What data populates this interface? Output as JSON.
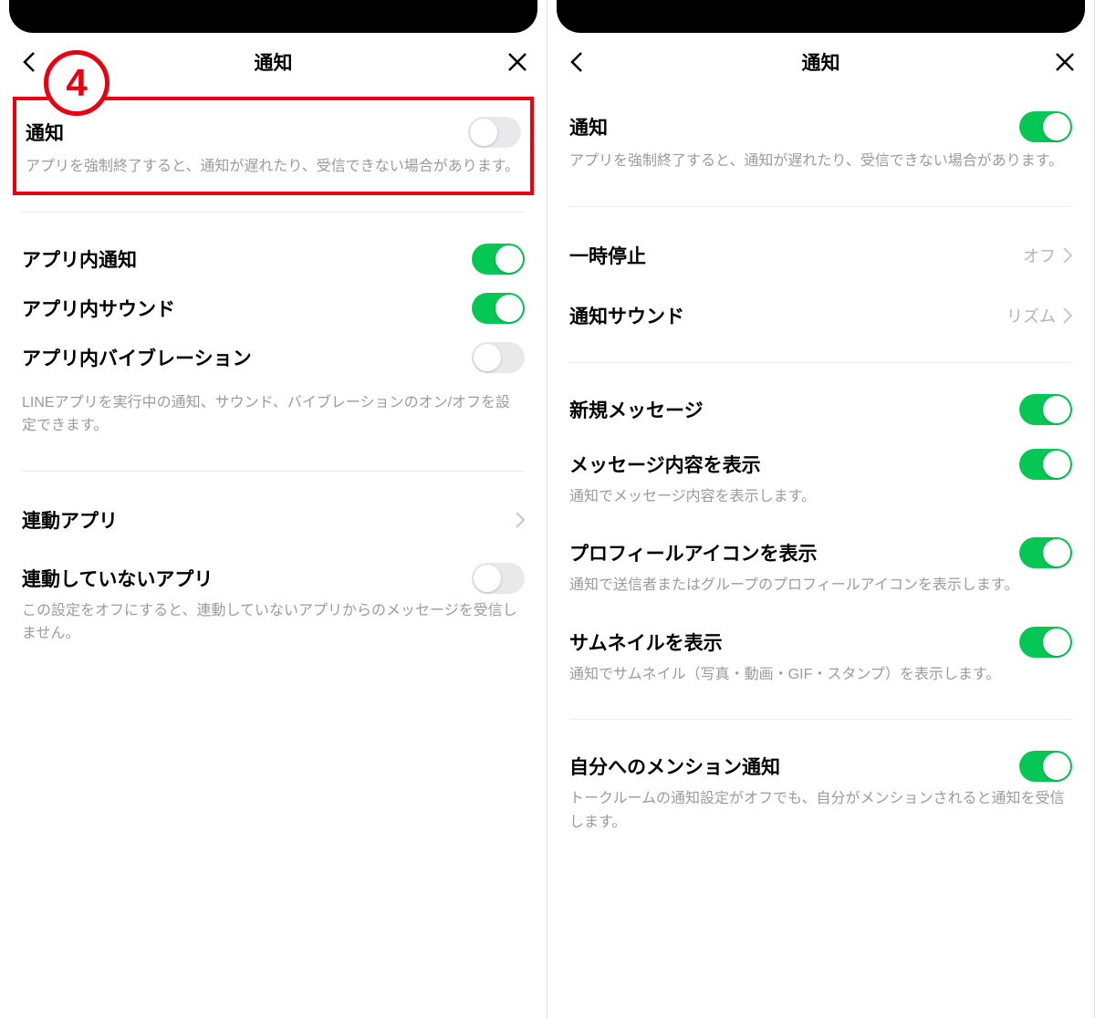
{
  "colors": {
    "accent_red": "#e60012",
    "toggle_on": "#06c755"
  },
  "badge_number": "4",
  "left": {
    "header_title": "通知",
    "main_toggle": {
      "label": "通知",
      "description": "アプリを強制終了すると、通知が遅れたり、受信できない場合があります。",
      "on": false
    },
    "app_toggles": [
      {
        "label": "アプリ内通知",
        "on": true
      },
      {
        "label": "アプリ内サウンド",
        "on": true
      },
      {
        "label": "アプリ内バイブレーション",
        "on": false
      }
    ],
    "app_description": "LINEアプリを実行中の通知、サウンド、バイブレーションのオン/オフを設定できます。",
    "linked_apps": {
      "label": "連動アプリ"
    },
    "unlinked_apps": {
      "label": "連動していないアプリ",
      "description": "この設定をオフにすると、連動していないアプリからのメッセージを受信しません。",
      "on": false
    }
  },
  "right": {
    "header_title": "通知",
    "main_toggle": {
      "label": "通知",
      "description": "アプリを強制終了すると、通知が遅れたり、受信できない場合があります。",
      "on": true
    },
    "pause": {
      "label": "一時停止",
      "value": "オフ"
    },
    "sound": {
      "label": "通知サウンド",
      "value": "リズム"
    },
    "items": [
      {
        "label": "新規メッセージ",
        "on": true,
        "description": ""
      },
      {
        "label": "メッセージ内容を表示",
        "on": true,
        "description": "通知でメッセージ内容を表示します。"
      },
      {
        "label": "プロフィールアイコンを表示",
        "on": true,
        "description": "通知で送信者またはグループのプロフィールアイコンを表示します。"
      },
      {
        "label": "サムネイルを表示",
        "on": true,
        "description": "通知でサムネイル（写真・動画・GIF・スタンプ）を表示します。"
      }
    ],
    "mention": {
      "label": "自分へのメンション通知",
      "on": true,
      "description": "トークルームの通知設定がオフでも、自分がメンションされると通知を受信します。"
    }
  }
}
